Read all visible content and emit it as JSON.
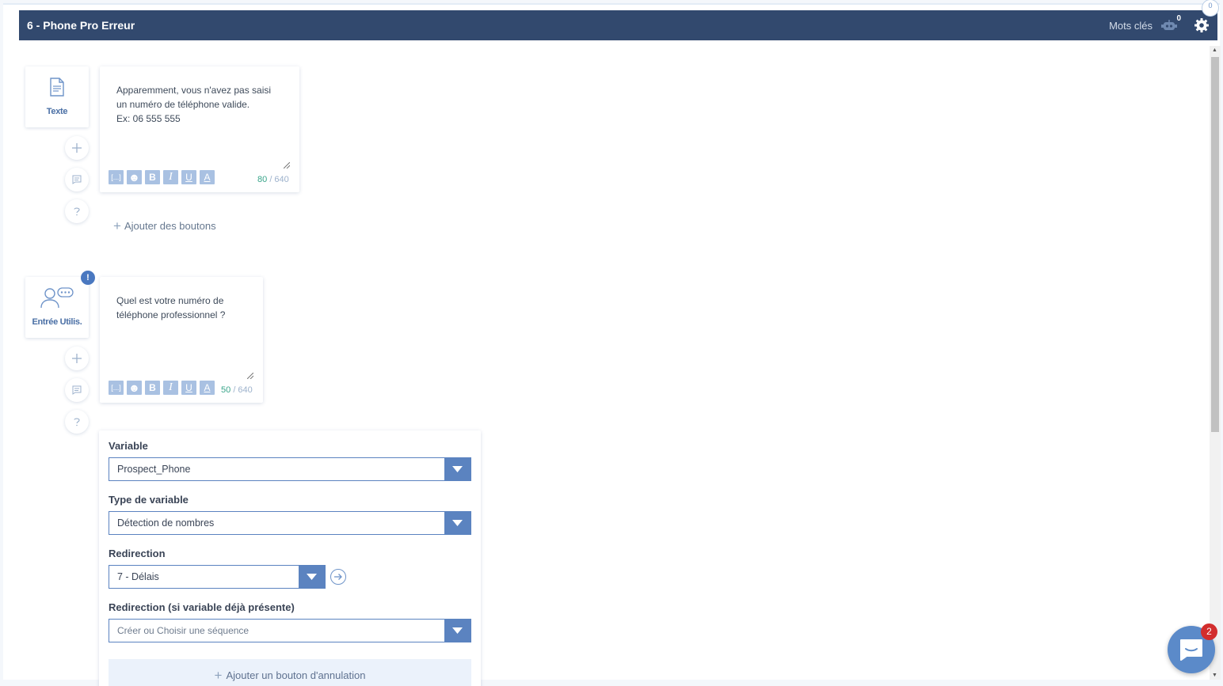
{
  "header": {
    "title": "6 - Phone Pro Erreur",
    "keywords_label": "Mots clés",
    "keywords_count": "0",
    "top_badge": "0"
  },
  "blocks": [
    {
      "type_label": "Texte",
      "message": "Apparemment, vous n'avez pas saisi\nun numéro de téléphone valide.\nEx: 06 555 555",
      "char_count": "80",
      "char_max": "/ 640",
      "add_buttons_label": "Ajouter des boutons"
    },
    {
      "type_label": "Entrée Utilis.",
      "warning": "!",
      "message": "Quel est votre numéro de\ntéléphone professionnel ?",
      "char_count": "50",
      "char_max": "/ 640"
    }
  ],
  "toolbar": {
    "brackets": "[...]",
    "emoji": "☻",
    "bold": "B",
    "italic": "I",
    "underline": "U",
    "color": "A"
  },
  "variable_panel": {
    "variable_label": "Variable",
    "variable_value": "Prospect_Phone",
    "type_label": "Type de variable",
    "type_value": "Détection de nombres",
    "redirection_label": "Redirection",
    "redirection_value": "7 - Délais",
    "redirection_present_label": "Redirection (si variable déjà présente)",
    "redirection_present_placeholder": "Créer ou Choisir une séquence",
    "cancel_button_label": "Ajouter un bouton d'annulation"
  },
  "chat": {
    "unread": "2"
  },
  "colors": {
    "header_bg": "#32496e",
    "accent": "#5b83c0",
    "toolbar_btn": "#a9c1e2",
    "counter_ok": "#3aa58a",
    "badge_red": "#d22d2d"
  }
}
